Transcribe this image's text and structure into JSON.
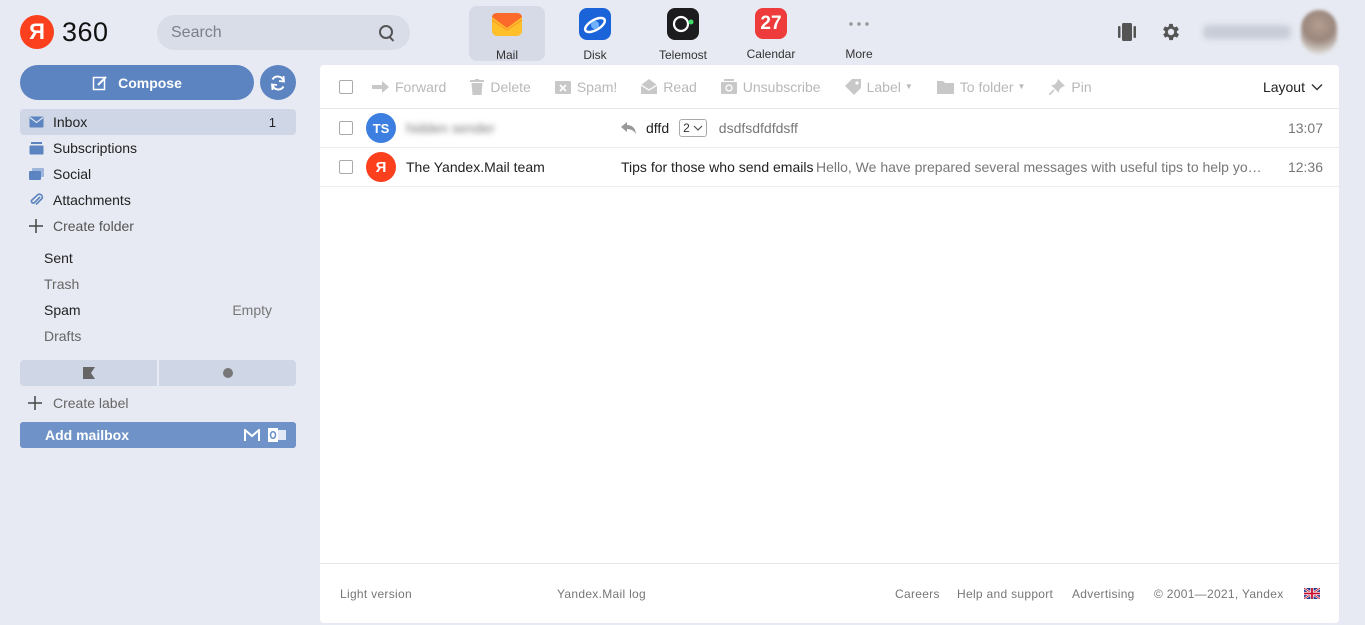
{
  "header": {
    "logo_letter": "Я",
    "logo_text": "360",
    "search_placeholder": "Search",
    "apps": [
      {
        "label": "Mail",
        "active": true
      },
      {
        "label": "Disk",
        "active": false
      },
      {
        "label": "Telemost",
        "active": false
      },
      {
        "label": "Calendar",
        "active": false,
        "badge": "27"
      },
      {
        "label": "More",
        "active": false
      }
    ]
  },
  "sidebar": {
    "compose_label": "Compose",
    "folders": [
      {
        "label": "Inbox",
        "count": "1",
        "icon": "inbox-icon"
      },
      {
        "label": "Subscriptions",
        "count": "",
        "icon": "subscriptions-icon"
      },
      {
        "label": "Social",
        "count": "",
        "icon": "social-icon"
      },
      {
        "label": "Attachments",
        "count": "",
        "icon": "paperclip-icon"
      },
      {
        "label": "Create folder",
        "count": "",
        "icon": "plus-icon"
      }
    ],
    "sub_folders": [
      {
        "label": "Sent",
        "extra": ""
      },
      {
        "label": "Trash",
        "extra": ""
      },
      {
        "label": "Spam",
        "extra": "Empty"
      },
      {
        "label": "Drafts",
        "extra": ""
      }
    ],
    "create_label": "Create label",
    "add_mailbox": "Add mailbox"
  },
  "toolbar": {
    "items": [
      "Forward",
      "Delete",
      "Spam!",
      "Read",
      "Unsubscribe",
      "Label",
      "To folder",
      "Pin"
    ],
    "layout_label": "Layout"
  },
  "messages": [
    {
      "initials": "TS",
      "avatar_color": "#3d7fe0",
      "sender": "hidden sender",
      "sender_blurred": true,
      "subject": "dffd",
      "thread_count": "2",
      "snippet": "dsdfsdfdfdsff",
      "time": "13:07"
    },
    {
      "initials": "Я",
      "avatar_color": "#fc3f1d",
      "sender": "The Yandex.Mail team",
      "sender_blurred": false,
      "subject": "Tips for those who send emails",
      "thread_count": "",
      "snippet": "Hello, We have prepared several messages with useful tips to help you master Yandex.Mail and make it work for you.",
      "time": "12:36"
    }
  ],
  "footer": {
    "light_version": "Light version",
    "mail_log": "Yandex.Mail log",
    "careers": "Careers",
    "help": "Help and support",
    "advertising": "Advertising",
    "copyright": "© 2001—2021, Yandex"
  },
  "colors": {
    "accent": "#5c84c0",
    "brand_red": "#fc3f1d",
    "background": "#e7eaf2"
  }
}
